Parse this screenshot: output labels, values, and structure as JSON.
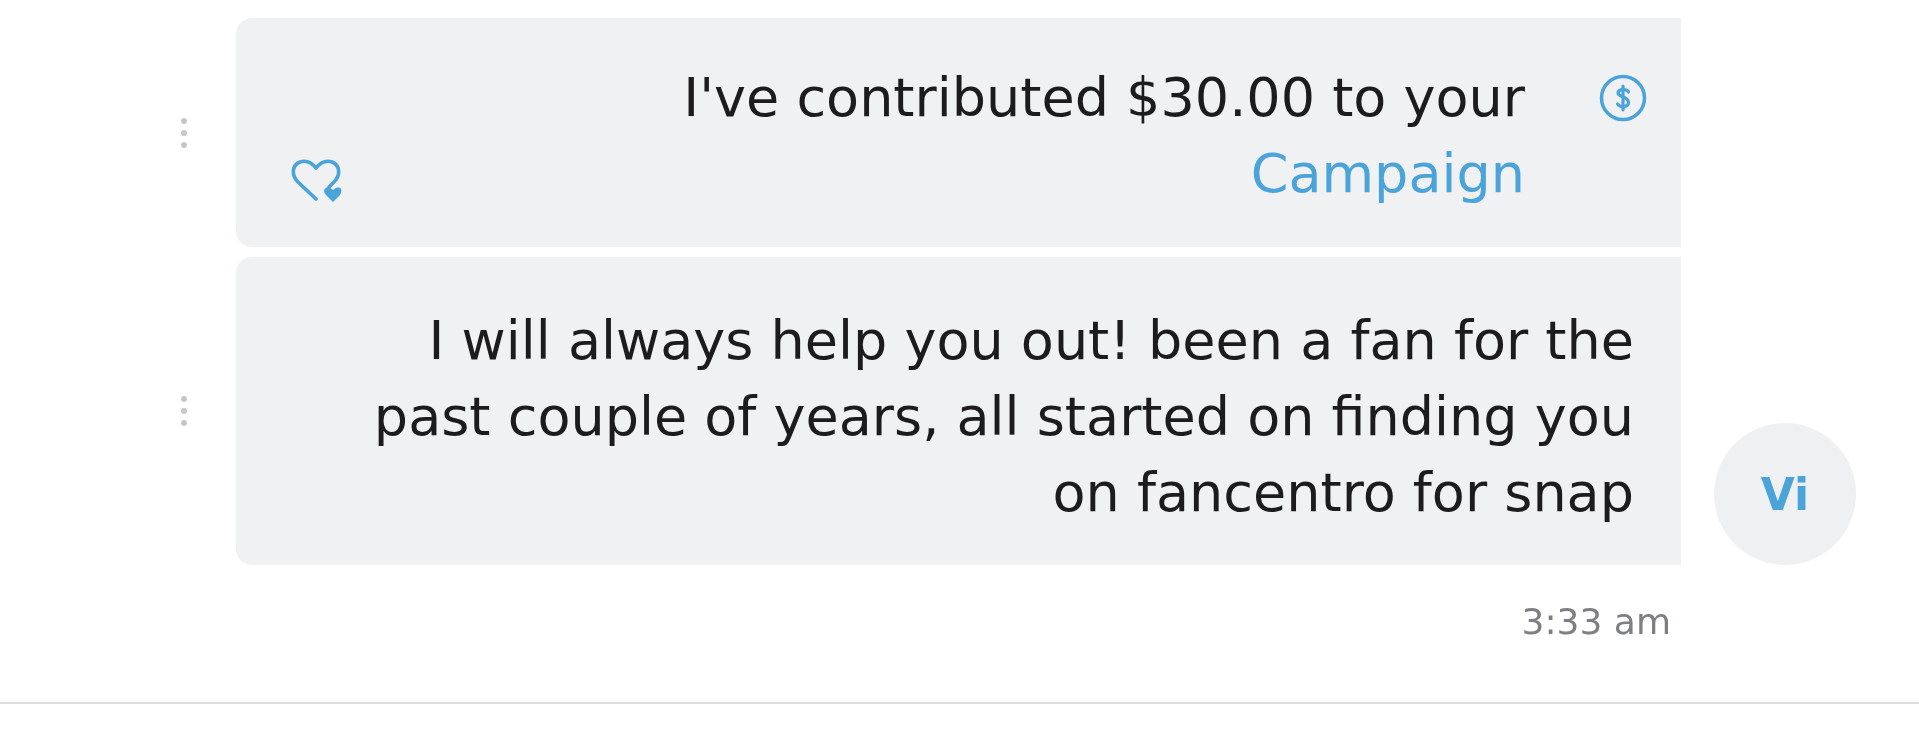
{
  "messages": [
    {
      "kind": "contribution",
      "text": "I've contributed $30.00 to your",
      "link": "Campaign"
    },
    {
      "kind": "text",
      "text": "I will always help you out! been a fan for the past couple of years, all started on finding you on fancentro for snap",
      "avatar": "Vi"
    }
  ],
  "timestamp": "3:33 am"
}
